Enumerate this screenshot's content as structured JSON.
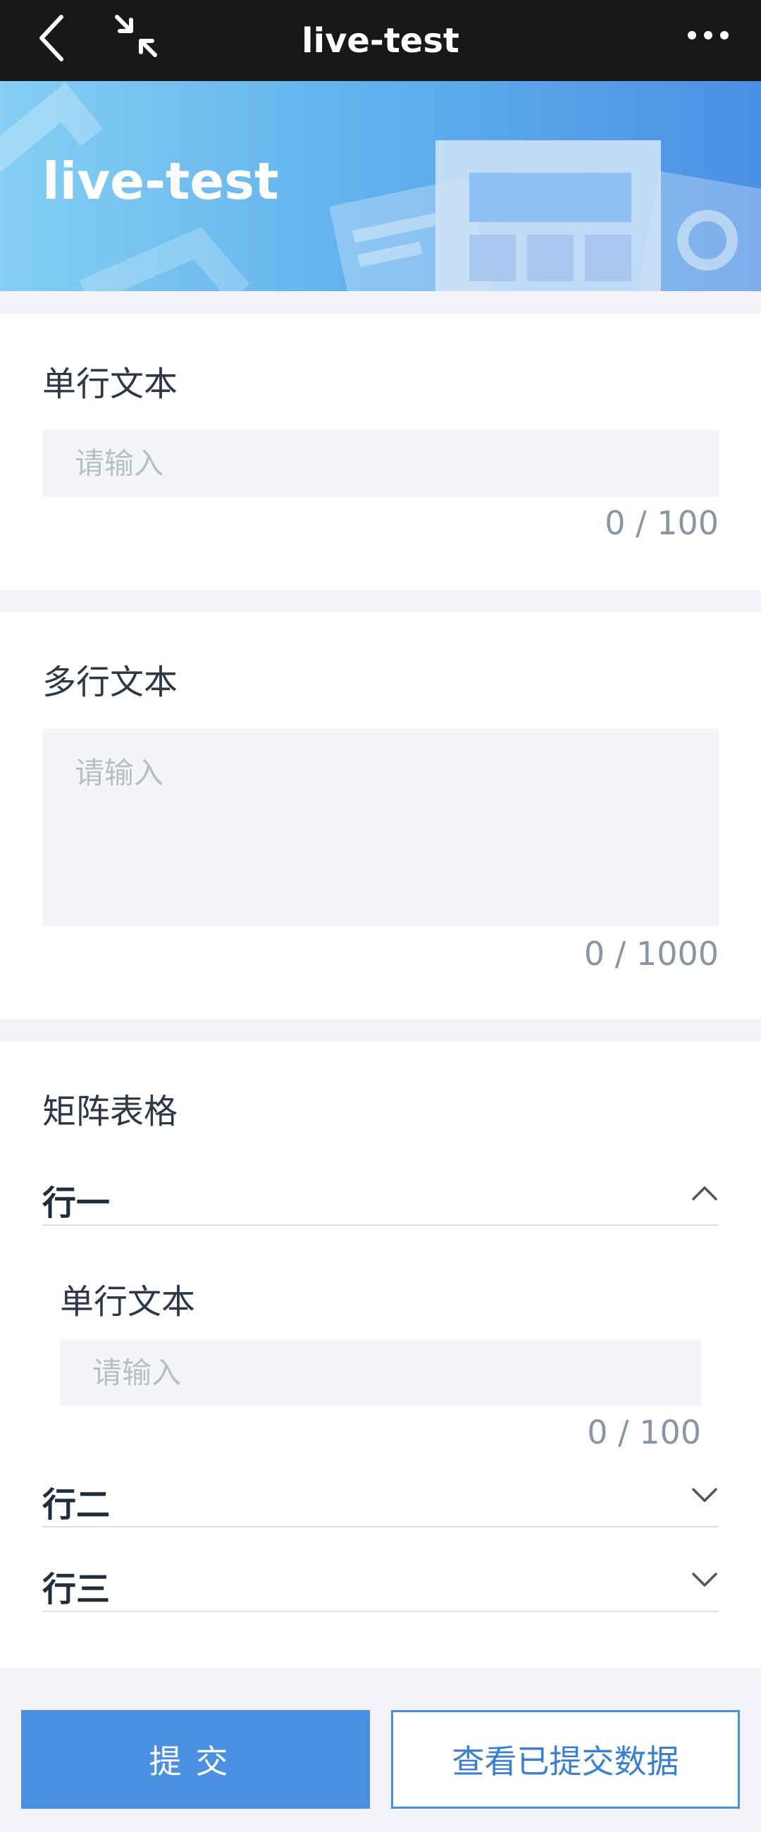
{
  "topbar": {
    "title": "live-test",
    "icons": {
      "back": "chevron-left-icon",
      "shrink": "collapse-arrows-icon",
      "more": "more-dots-icon"
    }
  },
  "banner": {
    "title": "live-test"
  },
  "fields": {
    "single_text": {
      "label": "单行文本",
      "placeholder": "请输入",
      "value": "",
      "counter": "0 / 100"
    },
    "multi_text": {
      "label": "多行文本",
      "placeholder": "请输入",
      "value": "",
      "counter": "0 / 1000"
    },
    "matrix": {
      "label": "矩阵表格",
      "rows": [
        {
          "label": "行一",
          "expanded": true,
          "icon": "chevron-up-icon",
          "sub_field": {
            "label": "单行文本",
            "placeholder": "请输入",
            "value": "",
            "counter": "0 / 100"
          }
        },
        {
          "label": "行二",
          "expanded": false,
          "icon": "chevron-down-icon"
        },
        {
          "label": "行三",
          "expanded": false,
          "icon": "chevron-down-icon"
        }
      ]
    }
  },
  "actions": {
    "submit": "提交",
    "view_submitted": "查看已提交数据"
  },
  "colors": {
    "primary": "#4a8fe0",
    "topbar": "#17181a",
    "background": "#f2f3f7"
  }
}
